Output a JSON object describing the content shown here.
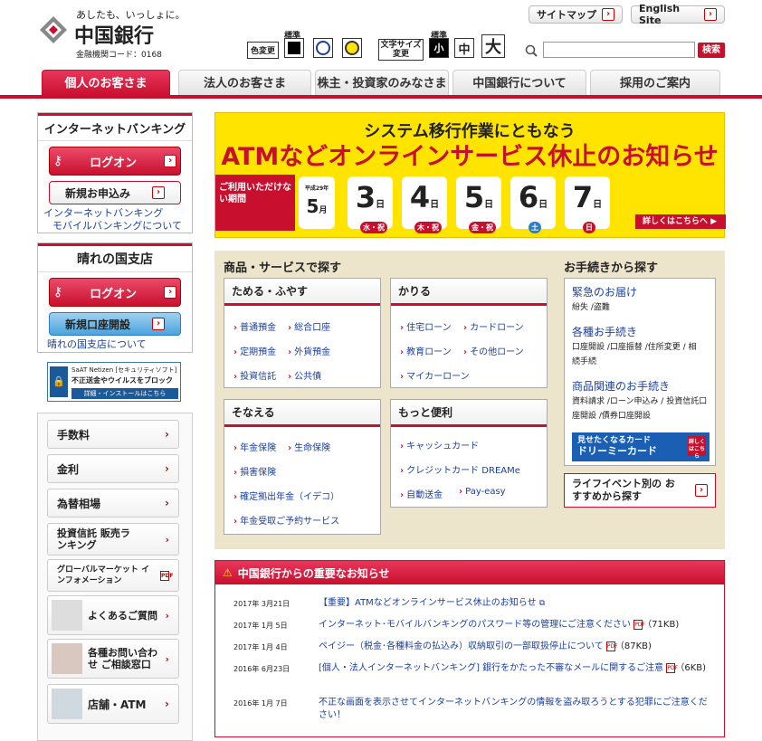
{
  "header": {
    "tagline": "あしたも、いっしょに。",
    "bank_name": "中国銀行",
    "bank_code": "金融機関コード：0168",
    "sitemap": "サイトマップ",
    "english": "English Site",
    "color_label": "色変更",
    "standard1": "標準",
    "text_size_label": "文字サイズ変更",
    "standard2": "標準",
    "size_small": "小",
    "size_medium": "中",
    "size_large": "大",
    "search_button": "検索",
    "search_value": ""
  },
  "tabs": [
    "個人のお客さま",
    "法人のお客さま",
    "株主・投資家のみなさま",
    "中国銀行について",
    "採用のご案内"
  ],
  "left": {
    "ib_title": "インターネットバンキング",
    "logon": "ログオン",
    "new_apply": "新規お申込み",
    "ib_link1": "インターネットバンキング",
    "ib_link2": "モバイルバンキングについて",
    "branch_title": "晴れの国支店",
    "logon2": "ログオン",
    "new_account": "新規口座開設",
    "branch_link": "晴れの国支店について",
    "security_line1": "SaAT Netizen [セキュリティソフト]",
    "security_line2": "不正送金やウイルスをブロック",
    "security_line3": "詳細・インストールはこちら",
    "menu": [
      "手数料",
      "金利",
      "為替相場",
      "投資信託 販売ランキング",
      "グローバルマーケット インフォメーション",
      "よくあるご質問",
      "各種お問い合わせ ご相談窓口",
      "店舗・ATM"
    ],
    "pdf": "PDF"
  },
  "banner": {
    "line1": "システム移行作業にともなう",
    "line2": "ATMなどオンラインサービス休止のお知らせ",
    "unavailable": "ご利用いただけない期間",
    "era": "平成29年",
    "month": "5",
    "month_unit": "月",
    "days": [
      {
        "d": "3",
        "w": "水・祝"
      },
      {
        "d": "4",
        "w": "木・祝"
      },
      {
        "d": "5",
        "w": "金・祝"
      },
      {
        "d": "6",
        "w": "土"
      },
      {
        "d": "7",
        "w": "日"
      }
    ],
    "day_unit": "日",
    "more": "詳しくはこちらへ ▶"
  },
  "products": {
    "title": "商品・サービスで探す",
    "boxes": [
      {
        "title": "ためる・ふやす",
        "links": [
          "普通預金",
          "総合口座",
          "定期預金",
          "外貨預金",
          "投資信託",
          "公共債"
        ]
      },
      {
        "title": "かりる",
        "links": [
          "住宅ローン",
          "カードローン",
          "教育ローン",
          "その他ローン",
          "マイカーローン"
        ]
      },
      {
        "title": "そなえる",
        "links": [
          "年金保険",
          "生命保険",
          "損害保険",
          "確定拠出年金（イデコ）",
          "年金受取ご予約サービス"
        ]
      },
      {
        "title": "もっと便利",
        "links": [
          "キャッシュカード",
          "クレジットカード DREAMe",
          "自動送金",
          "Pay-easy"
        ]
      }
    ]
  },
  "procedures": {
    "title": "お手続きから探す",
    "items": [
      {
        "head": "緊急のお届け",
        "sub": "紛失 /盗難"
      },
      {
        "head": "各種お手続き",
        "sub": "口座開設 /口座振替 /住所変更 / 相続手続"
      },
      {
        "head": "商品関連のお手続き",
        "sub": "資料請求 /ローン申込み / 投資信託口座開設 /債券口座開設"
      }
    ],
    "card_line1": "見せたくなるカード",
    "card_line2": "ドリーミーカード",
    "card_more": "詳しくはこちら",
    "life_event": "ライフイベント別の おすすめから探す"
  },
  "news": {
    "title": "中国銀行からの重要なお知らせ",
    "items": [
      {
        "date": "2017年 3月21日",
        "text": "【重要】ATMなどオンラインサービス休止のお知らせ",
        "size": ""
      },
      {
        "date": "2017年 1月 5日",
        "text": "インターネット･モバイルバンキングのパスワード等の管理にご注意ください",
        "size": "（71KB)"
      },
      {
        "date": "2017年 1月 4日",
        "text": "ペイジー（税金･各種料金の払込み）収納取引の一部取扱停止について",
        "size": "（87KB)"
      },
      {
        "date": "2016年 6月23日",
        "text": "[個人・法人インターネットバンキング] 銀行をかたった不審なメールに関するご注意",
        "size": "（6KB)"
      },
      {
        "date": "2016年 1月 7日",
        "text": "不正な画面を表示させてインターネットバンキングの情報を盗み取ろうとする犯罪にご注意ください！",
        "size": ""
      }
    ]
  },
  "colors": {
    "brand": "#c8102e",
    "banner": "#ffe400",
    "beige": "#ede4cc",
    "link": "#1a3fa0"
  }
}
